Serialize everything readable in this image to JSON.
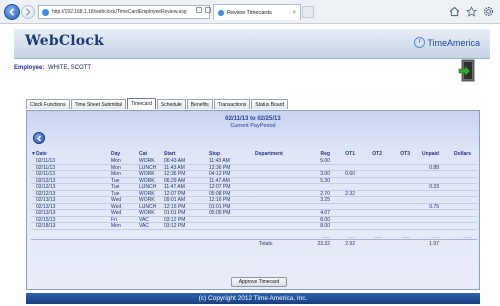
{
  "browser": {
    "address": "http://192.168.1.18/webclock/TimeCardEmployeeReview.asp",
    "tab_title": "Review Timecards",
    "tab_close": "×"
  },
  "header": {
    "logo_text": "WebClock",
    "brand_text": "TimeAmerica"
  },
  "employee": {
    "label": "Employee:",
    "name": "WHITE, SCOTT"
  },
  "tabs": [
    {
      "label": "Clock Functions"
    },
    {
      "label": "Time Sheet Submittal"
    },
    {
      "label": "Timecard"
    },
    {
      "label": "Schedule"
    },
    {
      "label": "Benefits"
    },
    {
      "label": "Transactions"
    },
    {
      "label": "Status Board"
    }
  ],
  "timecard": {
    "period": "02/11/13 to 02/25/13",
    "period_sub": "Current PayPeriod",
    "columns": {
      "sort": "▼",
      "date": "Date",
      "day": "Day",
      "cat": "Cat",
      "start": "Start",
      "stop": "Stop",
      "dept": "Department",
      "reg": "Reg",
      "ot1": "OT1",
      "ot2": "OT2",
      "ot3": "OT3",
      "unpaid": "Unpaid",
      "dollars": "Dollars"
    },
    "rows": [
      {
        "date": "02/11/13",
        "day": "Mon",
        "cat": "WORK",
        "start": "06:43 AM",
        "stop": "11:43 AM",
        "reg": "5.00",
        "ot1": "",
        "unpaid": ""
      },
      {
        "date": "02/11/13",
        "day": "Mon",
        "cat": "LUNCH",
        "start": "11:43 AM",
        "stop": "12:36 PM",
        "reg": "",
        "ot1": "",
        "unpaid": "0.88"
      },
      {
        "date": "02/11/13",
        "day": "Mon",
        "cat": "WORK",
        "start": "12:36 PM",
        "stop": "04:12 PM",
        "reg": "3.00",
        "ot1": "0.60",
        "unpaid": ""
      },
      {
        "date": "02/12/13",
        "day": "Tue",
        "cat": "WORK",
        "start": "06:29 AM",
        "stop": "11:47 AM",
        "reg": "5.30",
        "ot1": "",
        "unpaid": ""
      },
      {
        "date": "02/12/13",
        "day": "Tue",
        "cat": "LUNCH",
        "start": "11:47 AM",
        "stop": "12:07 PM",
        "reg": "",
        "ot1": "",
        "unpaid": "0.33"
      },
      {
        "date": "02/12/13",
        "day": "Tue",
        "cat": "WORK",
        "start": "12:07 PM",
        "stop": "05:08 PM",
        "reg": "2.70",
        "ot1": "2.32",
        "unpaid": ""
      },
      {
        "date": "02/13/13",
        "day": "Wed",
        "cat": "WORK",
        "start": "09:01 AM",
        "stop": "12:16 PM",
        "reg": "3.25",
        "ot1": "",
        "unpaid": ""
      },
      {
        "date": "02/13/13",
        "day": "Wed",
        "cat": "LUNCH",
        "start": "12:16 PM",
        "stop": "01:01 PM",
        "reg": "",
        "ot1": "",
        "unpaid": "0.75"
      },
      {
        "date": "02/13/13",
        "day": "Wed",
        "cat": "WORK",
        "start": "01:01 PM",
        "stop": "05:05 PM",
        "reg": "4.07",
        "ot1": "",
        "unpaid": ""
      },
      {
        "date": "02/15/13",
        "day": "Fri",
        "cat": "VAC",
        "start": "03:12 PM",
        "stop": "",
        "reg": "8.00",
        "ot1": "",
        "unpaid": ""
      },
      {
        "date": "02/18/13",
        "day": "Mon",
        "cat": "VAC",
        "start": "03:12 PM",
        "stop": "",
        "reg": "8.00",
        "ot1": "",
        "unpaid": ""
      }
    ],
    "dashes": "------",
    "totals": {
      "label": "Totals:",
      "reg": "23.32",
      "ot1": "2.92",
      "unpaid": "1.97"
    },
    "approve_label": "Approve Timecard"
  },
  "footer": {
    "text": "(c) Copyright 2012 Time America, Inc."
  }
}
